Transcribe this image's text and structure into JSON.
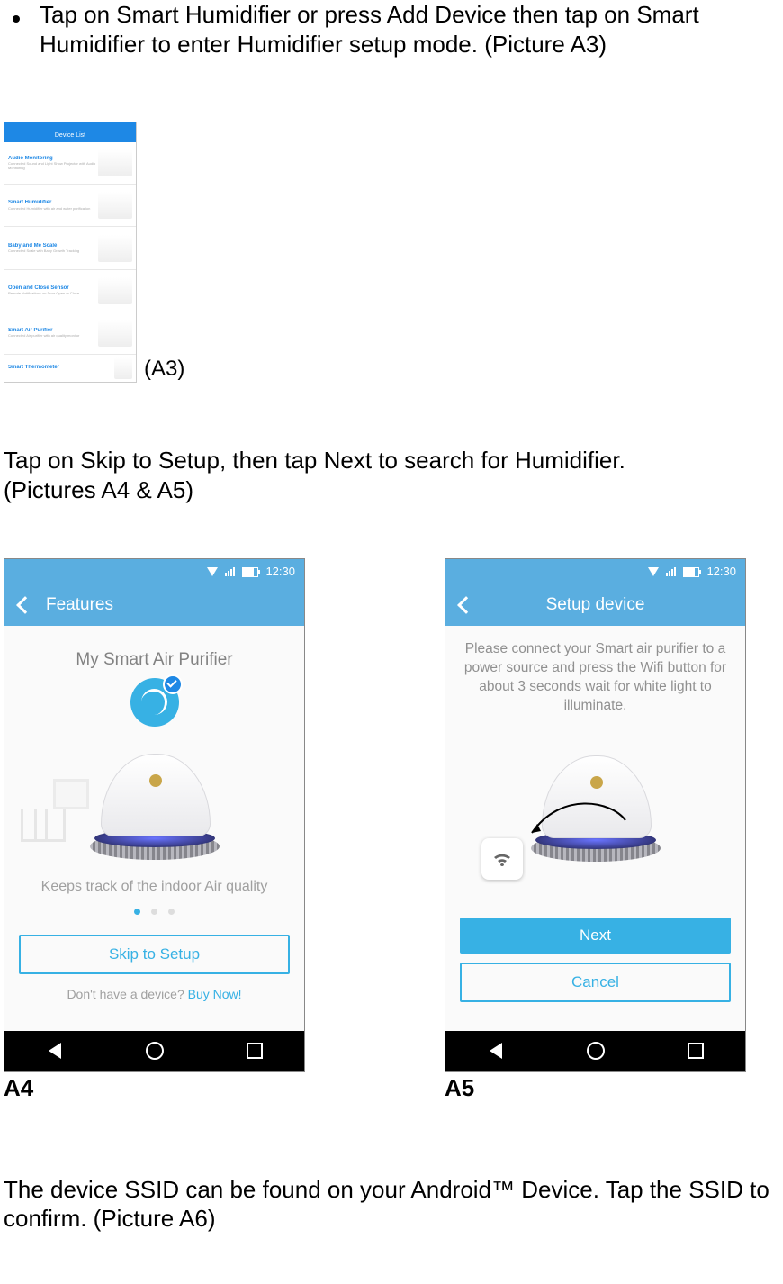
{
  "intro": {
    "bullet_text": "Tap on Smart Humidifier or press Add Device then tap on Smart Humidifier to enter Humidifier setup mode. (Picture A3)"
  },
  "a3": {
    "label": "(A3)",
    "title": "Device List",
    "items": [
      {
        "h": "Audio Monitoring",
        "d": "Connected Sound and Light Show Projector with Audio Monitoring"
      },
      {
        "h": "Smart Humidifier",
        "d": "Connected Humidifier with air and water purification"
      },
      {
        "h": "Baby and Me Scale",
        "d": "Connected Scale with Baby Growth Tracking"
      },
      {
        "h": "Open and Close Sensor",
        "d": "Remote Notifications on Door Open or Close"
      },
      {
        "h": "Smart Air Purifier",
        "d": "Connected Air purifier with air quality monitor"
      },
      {
        "h": "Smart Thermometer",
        "d": ""
      }
    ]
  },
  "mid": {
    "l1": "Tap on Skip to Setup, then tap Next to search for Humidifier.",
    "l2": "(Pictures A4 & A5)"
  },
  "status_time": "12:30",
  "a4": {
    "title": "Features",
    "heading": "My Smart Air Purifier",
    "subtitle": "Keeps track of the indoor Air quality",
    "skip": "Skip to Setup",
    "nodev": "Don't have a device? ",
    "buy": "Buy Now!",
    "caption": "A4"
  },
  "a5": {
    "title": "Setup device",
    "instr": "Please connect your Smart air purifier to a power source and press the Wifi button for about 3 seconds wait for white light to illuminate.",
    "next": "Next",
    "cancel": "Cancel",
    "caption": "A5"
  },
  "outro": "The device SSID can be found on your Android™ Device. Tap the SSID to confirm. (Picture A6)"
}
